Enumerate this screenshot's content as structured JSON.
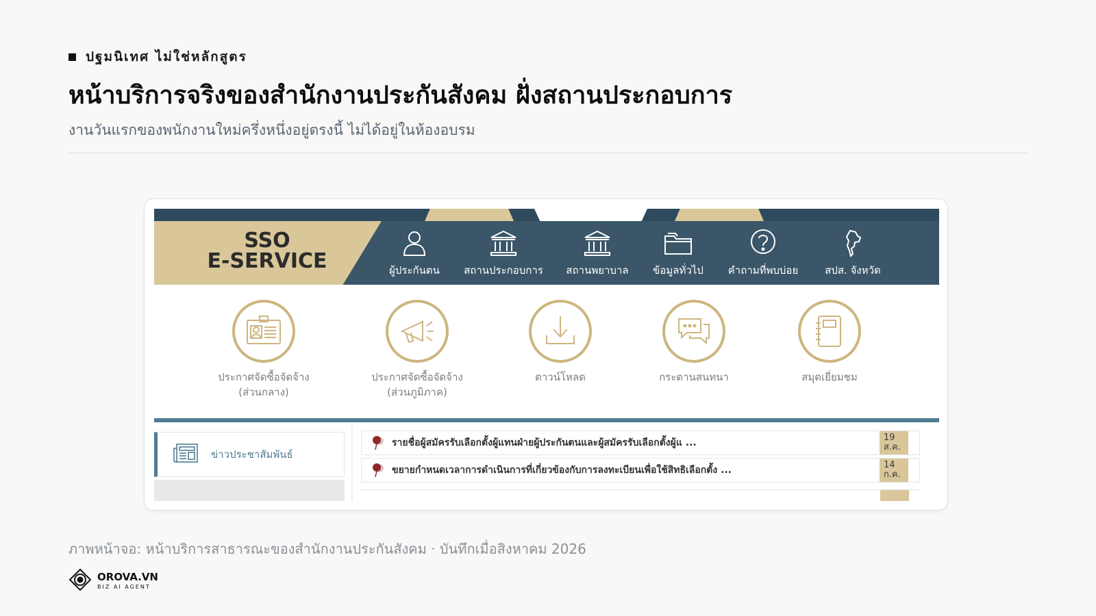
{
  "header": {
    "kicker": "ปฐมนิเทศ ไม่ใช่หลักสูตร",
    "title": "หน้าบริการจริงของสำนักงานประกันสังคม ฝั่งสถานประกอบการ",
    "subtitle": "งานวันแรกของพนักงานใหม่ครึ่งหนึ่งอยู่ตรงนี้ ไม่ได้อยู่ในห้องอบรม"
  },
  "screenshot": {
    "brand": {
      "line1": "SSO",
      "line2": "E-SERVICE"
    },
    "nav": [
      {
        "label": "ผู้ประกันตน",
        "icon": "person-icon"
      },
      {
        "label": "สถานประกอบการ",
        "icon": "building-icon"
      },
      {
        "label": "สถานพยาบาล",
        "icon": "hospital-building-icon"
      },
      {
        "label": "ข้อมูลทั่วไป",
        "icon": "folder-icon"
      },
      {
        "label": "คำถามที่พบบ่อย",
        "icon": "question-icon"
      },
      {
        "label": "สปส. จังหวัด",
        "icon": "thailand-map-icon"
      }
    ],
    "services": [
      {
        "line1": "ประกาศจัดซื้อจัดจ้าง",
        "line2": "(ส่วนกลาง)",
        "icon": "id-card-icon"
      },
      {
        "line1": "ประกาศจัดซื้อจัดจ้าง",
        "line2": "(ส่วนภูมิภาค)",
        "icon": "megaphone-icon"
      },
      {
        "line1": "ดาวน์โหลด",
        "line2": "",
        "icon": "download-icon"
      },
      {
        "line1": "กระดานสนทนา",
        "line2": "",
        "icon": "chat-icon"
      },
      {
        "line1": "สมุดเยี่ยมชม",
        "line2": "",
        "icon": "notebook-icon"
      }
    ],
    "news_tab": {
      "label": "ข่าวประชาสัมพันธ์",
      "icon": "newspaper-icon"
    },
    "news": [
      {
        "title": "รายชื่อผู้สมัครรับเลือกตั้งผู้แทนฝ่ายผู้ประกันตนและผู้สมัครรับเลือกตั้งผู้แ ...",
        "day": "19",
        "month": "ส.ค."
      },
      {
        "title": "ขยายกำหนดเวลาการดำเนินการที่เกี่ยวข้องกับการลงทะเบียนเพื่อใช้สิทธิเลือกตั้ง ...",
        "day": "14",
        "month": "ก.ค."
      }
    ],
    "colors": {
      "navy": "#3a5668",
      "gold": "#d9c79a",
      "ring": "#cdb57f",
      "accent_blue": "#4f7d92"
    }
  },
  "caption": "ภาพหน้าจอ: หน้าบริการสาธารณะของสำนักงานประกันสังคม · บันทึกเมื่อสิงหาคม 2026",
  "logo": {
    "name": "OROVA.VN",
    "tagline": "BIZ AI AGENT"
  }
}
